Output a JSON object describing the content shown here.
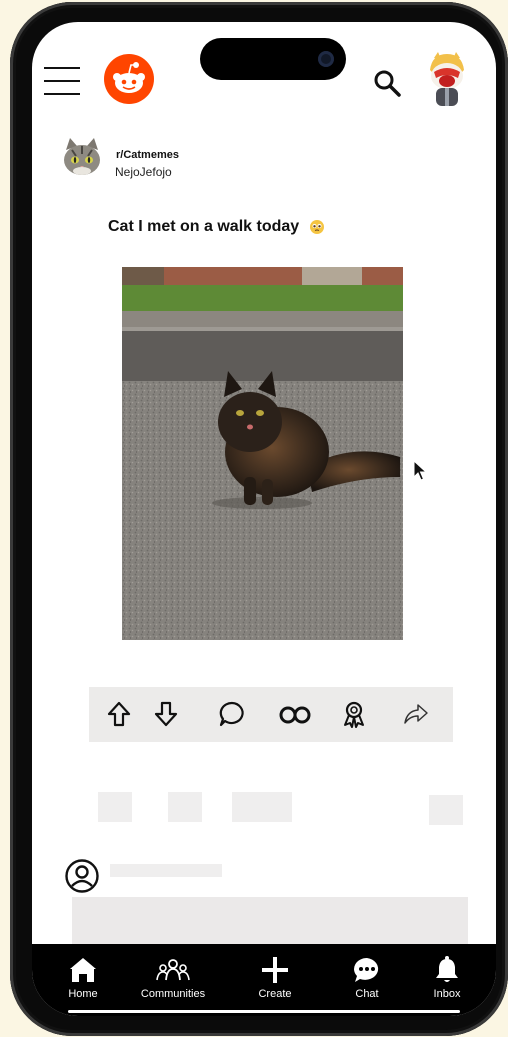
{
  "header": {
    "menu_icon": "hamburger-icon",
    "logo": "reddit-logo",
    "search_icon": "search-icon",
    "user_avatar": "user-avatar"
  },
  "post": {
    "subreddit": "r/Catmemes",
    "author": "NejoJefojo",
    "title": "Cat I met on a walk today",
    "emoji": "pleading-face-emoji",
    "image": "photo of a fluffy dark tortoiseshell cat sitting on an asphalt road"
  },
  "actions": [
    {
      "name": "upvote",
      "icon": "arrow-up-icon"
    },
    {
      "name": "downvote",
      "icon": "arrow-down-icon"
    },
    {
      "name": "comment",
      "icon": "speech-bubble-icon"
    },
    {
      "name": "crosspost",
      "icon": "infinity-icon"
    },
    {
      "name": "award",
      "icon": "award-ribbon-icon"
    },
    {
      "name": "share",
      "icon": "share-arrow-icon"
    }
  ],
  "nav": {
    "home": "Home",
    "communities": "Communities",
    "create": "Create",
    "chat": "Chat",
    "inbox": "Inbox"
  },
  "colors": {
    "brand": "#ff4500",
    "nav_background": "#000000",
    "action_bar": "#ecebea",
    "skeleton": "#efeeee"
  }
}
